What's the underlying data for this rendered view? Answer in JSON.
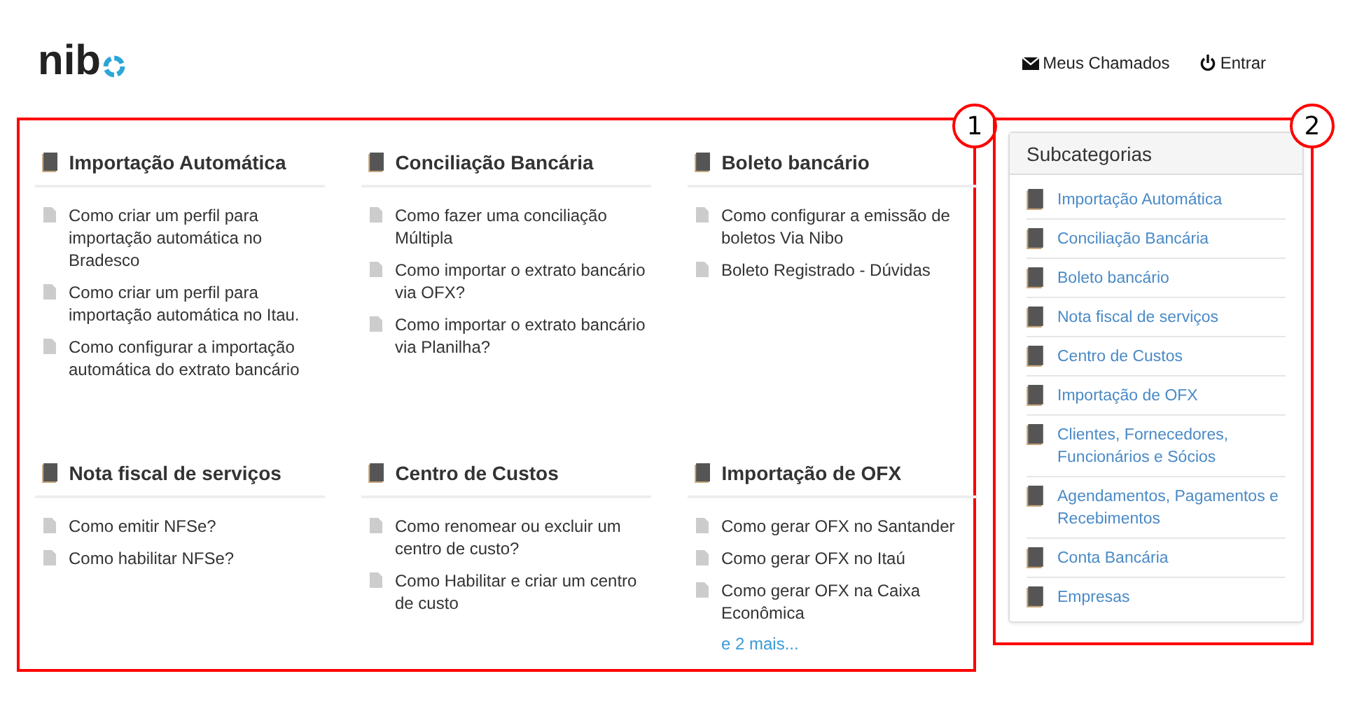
{
  "logo": {
    "text": "nib"
  },
  "nav": [
    {
      "kind": "mail",
      "label": "Meus Chamados"
    },
    {
      "kind": "power",
      "label": "Entrar"
    }
  ],
  "categories": [
    {
      "title": "Importação Automática",
      "articles": [
        "Como criar um perfil para importação automática no Bradesco",
        "Como criar um perfil para importação automática no Itau.",
        "Como configurar a importação automática do extrato bancário"
      ]
    },
    {
      "title": "Conciliação Bancária",
      "articles": [
        "Como fazer uma conciliação Múltipla",
        "Como importar o extrato bancário via OFX?",
        "Como importar o extrato bancário via Planilha?"
      ]
    },
    {
      "title": "Boleto bancário",
      "articles": [
        "Como configurar a emissão de boletos Via Nibo",
        "Boleto Registrado - Dúvidas"
      ]
    },
    {
      "title": "Nota fiscal de serviços",
      "articles": [
        "Como emitir NFSe?",
        "Como habilitar NFSe?"
      ]
    },
    {
      "title": "Centro de Custos",
      "articles": [
        "Como renomear ou excluir um centro de custo?",
        "Como Habilitar e criar um centro de custo"
      ]
    },
    {
      "title": "Importação de OFX",
      "articles": [
        "Como gerar OFX no Santander",
        "Como gerar OFX no Itaú",
        "Como gerar OFX na Caixa Econômica"
      ],
      "more": "e 2 mais..."
    }
  ],
  "subcategories": {
    "title": "Subcategorias",
    "items": [
      "Importação Automática",
      "Conciliação Bancária",
      "Boleto bancário",
      "Nota fiscal de serviços",
      "Centro de Custos",
      "Importação de OFX",
      "Clientes, Fornecedores, Funcionários e Sócios",
      "Agendamentos, Pagamentos e Recebimentos",
      "Conta Bancária",
      "Empresas"
    ]
  },
  "annotations": [
    {
      "label": "1"
    },
    {
      "label": "2"
    }
  ]
}
